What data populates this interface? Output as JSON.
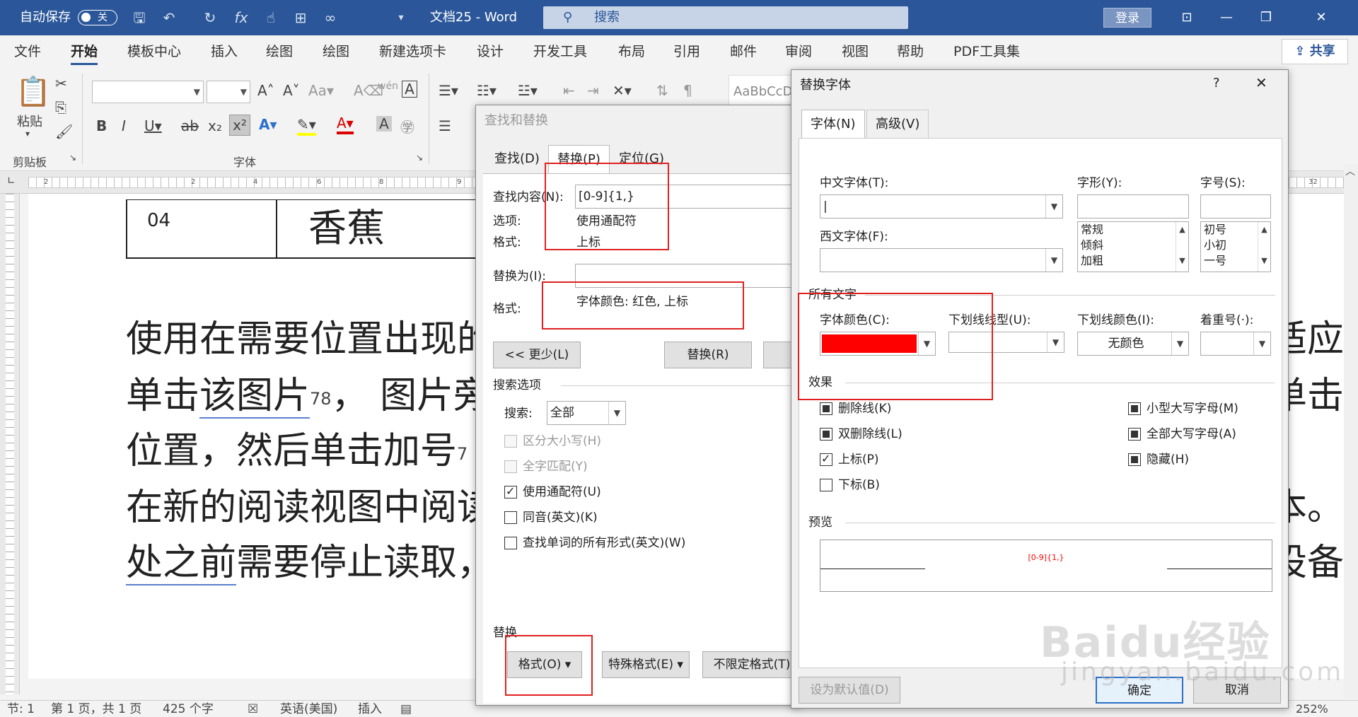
{
  "titlebar": {
    "autosave_label": "自动保存",
    "autosave_state": "关",
    "doc_title": "文档25 - Word",
    "search_placeholder": "搜索",
    "login_label": "登录"
  },
  "menu": {
    "tabs": [
      "文件",
      "开始",
      "模板中心",
      "插入",
      "绘图",
      "绘图",
      "新建选项卡",
      "设计",
      "开发工具",
      "布局",
      "引用",
      "邮件",
      "审阅",
      "视图",
      "帮助",
      "PDF工具集"
    ],
    "active_index": 1,
    "share_label": "共享"
  },
  "ribbon": {
    "paste_label": "粘贴",
    "clipboard_group": "剪贴板",
    "font_group": "字体",
    "style_preview": "AaBbCcD"
  },
  "ruler": {
    "numbers": [
      "2",
      "2",
      "4",
      "6",
      "8",
      "9",
      "32"
    ]
  },
  "document": {
    "table_num": "04",
    "table_name": "香蕉",
    "line1": "使用在需要位置出现的",
    "line1_right": "适应",
    "line2_pre": "单击",
    "line2_ul": "该图片",
    "line2_sup": "78",
    "line2_post": "，  图片旁",
    "line2_right": "单击",
    "line3": "位置，然后单击加号",
    "line3_sup": "7",
    "line4": "在新的阅读视图中阅读",
    "line4_right": "本。",
    "line5_ul": "处之前",
    "line5_post": "需要停止读取，",
    "line5_right": "设备"
  },
  "find_replace": {
    "title": "查找和替换",
    "tabs": [
      "查找(D)",
      "替换(P)",
      "定位(G)"
    ],
    "find_label": "查找内容(N):",
    "find_value": "[0-9]{1,}",
    "options_label": "选项:",
    "options_value": "使用通配符",
    "format_label": "格式:",
    "format_value": "上标",
    "replace_label": "替换为(I):",
    "replace_value": "",
    "format2_label": "格式:",
    "format2_value": "字体颜色: 红色, 上标",
    "less_button": "<< 更少(L)",
    "replace_button": "替换(R)",
    "search_options": "搜索选项",
    "search_label": "搜索:",
    "search_value": "全部",
    "checkboxes": [
      {
        "label": "区分大小写(H)",
        "state": "disabled"
      },
      {
        "label": "全字匹配(Y)",
        "state": "disabled"
      },
      {
        "label": "使用通配符(U)",
        "state": "checked"
      },
      {
        "label": "同音(英文)(K)",
        "state": "unchecked"
      },
      {
        "label": "查找单词的所有形式(英文)(W)",
        "state": "unchecked"
      }
    ],
    "replace_section": "替换",
    "format_button": "格式(O) ▾",
    "special_button": "特殊格式(E) ▾",
    "nolimit_button": "不限定格式(T)"
  },
  "replace_font": {
    "title": "替换字体",
    "help": "?",
    "tabs": [
      "字体(N)",
      "高级(V)"
    ],
    "cn_font_label": "中文字体(T):",
    "cn_font_value": "|",
    "west_font_label": "西文字体(F):",
    "west_font_value": "",
    "style_label": "字形(Y):",
    "style_value": "",
    "style_options": [
      "常规",
      "倾斜",
      "加粗"
    ],
    "size_label": "字号(S):",
    "size_value": "",
    "size_options": [
      "初号",
      "小初",
      "一号"
    ],
    "all_text": "所有文字",
    "color_label": "字体颜色(C):",
    "color_value": "#ff0000",
    "underline_label": "下划线线型(U):",
    "underline_color_label": "下划线颜色(I):",
    "underline_color_value": "无颜色",
    "emphasis_label": "着重号(·):",
    "effects": "效果",
    "effect_items": [
      {
        "label": "删除线(K)",
        "state": "indeterminate"
      },
      {
        "label": "双删除线(L)",
        "state": "indeterminate"
      },
      {
        "label": "上标(P)",
        "state": "checked"
      },
      {
        "label": "下标(B)",
        "state": "unchecked"
      }
    ],
    "effect_items_right": [
      {
        "label": "小型大写字母(M)",
        "state": "indeterminate"
      },
      {
        "label": "全部大写字母(A)",
        "state": "indeterminate"
      },
      {
        "label": "隐藏(H)",
        "state": "indeterminate"
      }
    ],
    "preview_label": "预览",
    "preview_text": "[0-9]{1,}",
    "set_default": "设为默认值(D)",
    "ok": "确定",
    "cancel": "取消"
  },
  "statusbar": {
    "section": "节: 1",
    "page": "第 1 页，共 1 页",
    "words": "425 个字",
    "lang": "英语(美国)",
    "mode": "插入",
    "zoom": "252%"
  },
  "watermark": {
    "logo": "Baidu经验",
    "url": "jingyan.baidu.com"
  },
  "accent_color": "#2b579a"
}
